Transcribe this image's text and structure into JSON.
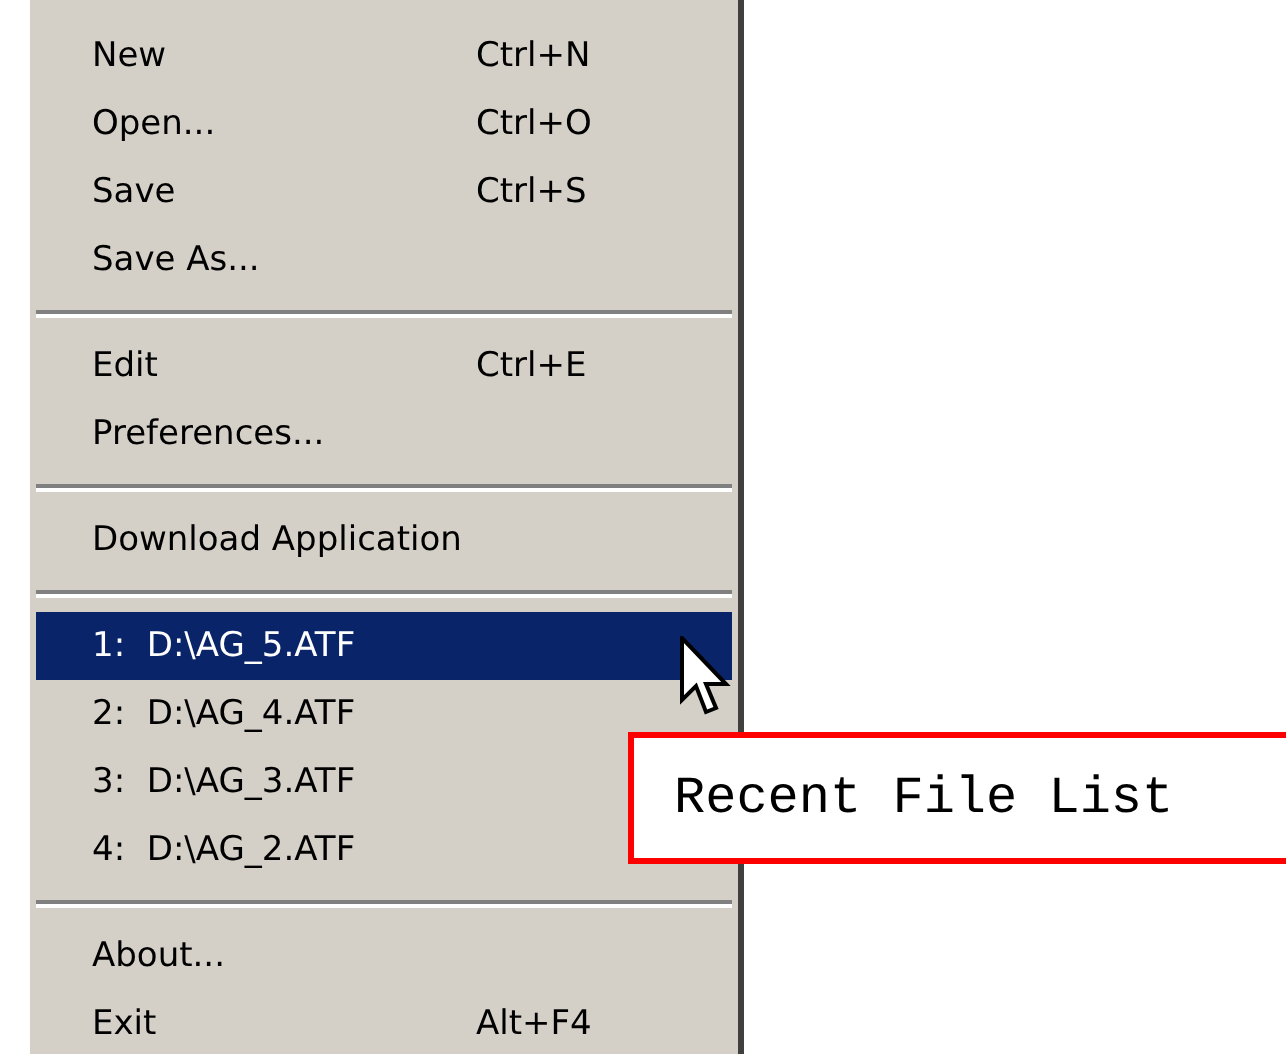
{
  "menu": {
    "entries": [
      {
        "kind": "item",
        "label": "New",
        "shortcut": "Ctrl+N",
        "selected": false
      },
      {
        "kind": "item",
        "label": "Open...",
        "shortcut": "Ctrl+O",
        "selected": false
      },
      {
        "kind": "item",
        "label": "Save",
        "shortcut": "Ctrl+S",
        "selected": false
      },
      {
        "kind": "item",
        "label": "Save As...",
        "selected": false
      },
      {
        "kind": "separator"
      },
      {
        "kind": "item",
        "label": "Edit",
        "shortcut": "Ctrl+E",
        "selected": false
      },
      {
        "kind": "item",
        "label": "Preferences...",
        "selected": false
      },
      {
        "kind": "separator"
      },
      {
        "kind": "item",
        "label": "Download Application",
        "selected": false
      },
      {
        "kind": "separator"
      },
      {
        "kind": "item",
        "label": "1:  D:\\AG_5.ATF",
        "selected": true
      },
      {
        "kind": "item",
        "label": "2:  D:\\AG_4.ATF",
        "selected": false
      },
      {
        "kind": "item",
        "label": "3:  D:\\AG_3.ATF",
        "selected": false
      },
      {
        "kind": "item",
        "label": "4:  D:\\AG_2.ATF",
        "selected": false
      },
      {
        "kind": "separator"
      },
      {
        "kind": "item",
        "label": "About...",
        "selected": false
      },
      {
        "kind": "item",
        "label": "Exit",
        "shortcut": "Alt+F4",
        "selected": false
      }
    ]
  },
  "callout": {
    "text": "Recent File List"
  }
}
